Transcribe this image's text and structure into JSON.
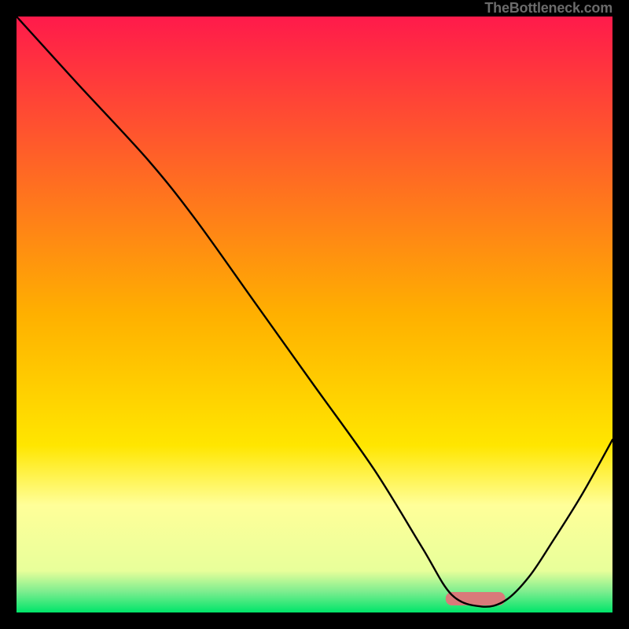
{
  "watermark": "TheBottleneck.com",
  "chart_data": {
    "type": "line",
    "title": "",
    "xlabel": "",
    "ylabel": "",
    "xlim": [
      0,
      100
    ],
    "ylim": [
      0,
      100
    ],
    "optimal_band": {
      "x_start": 72,
      "x_end": 82,
      "color": "#d97a7a"
    },
    "gradient_stops": [
      {
        "offset": 0.0,
        "color": "#ff1a4b"
      },
      {
        "offset": 0.5,
        "color": "#ffb000"
      },
      {
        "offset": 0.72,
        "color": "#ffe600"
      },
      {
        "offset": 0.82,
        "color": "#ffff99"
      },
      {
        "offset": 0.93,
        "color": "#e8ff9a"
      },
      {
        "offset": 0.965,
        "color": "#7ded8f"
      },
      {
        "offset": 1.0,
        "color": "#00e56a"
      }
    ],
    "series": [
      {
        "name": "bottleneck-curve",
        "x": [
          0,
          10,
          22,
          30,
          40,
          50,
          60,
          68,
          73,
          78,
          82,
          86,
          90,
          95,
          100
        ],
        "y": [
          100,
          89,
          76,
          66,
          52,
          38,
          24,
          11,
          3,
          1,
          2,
          6,
          12,
          20,
          29
        ]
      }
    ]
  }
}
